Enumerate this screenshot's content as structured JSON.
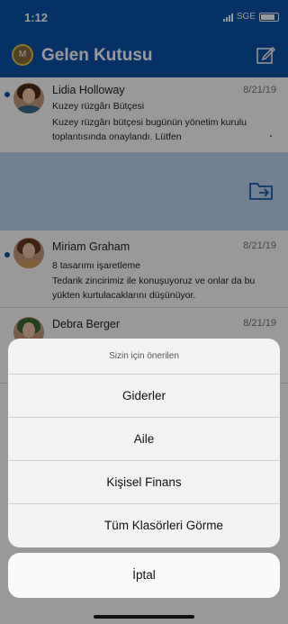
{
  "status_bar": {
    "time": "1:12",
    "carrier": "SGE"
  },
  "header": {
    "title": "Gelen Kutusu",
    "avatar_letter": "M"
  },
  "mails": [
    {
      "sender": "Lidia Holloway",
      "date": "8/21/19",
      "subject": "Kuzey rüzgârı Bütçesi",
      "preview": "Kuzey rüzgârı bütçesi bugünün yönetim kurulu toplantısında onaylandı. Lütfen"
    },
    {
      "sender": "Miriam Graham",
      "date": "8/21/19",
      "subject": "8 tasarımı işaretleme",
      "preview": "Tedarik zincirimiz ile konuşuyoruz ve onlar da bu yükten kurtulacaklarını düşünüyor."
    },
    {
      "sender": "Debra Berger",
      "date": "8/21/19"
    }
  ],
  "action_sheet": {
    "title": "Sizin için önerilen",
    "items": [
      "Giderler",
      "Aile",
      "Kişisel Finans",
      "Tüm Klasörleri Görme"
    ],
    "cancel": "İptal"
  },
  "colors": {
    "brand": "#0b52a8",
    "swipe": "#bcd7f5"
  }
}
